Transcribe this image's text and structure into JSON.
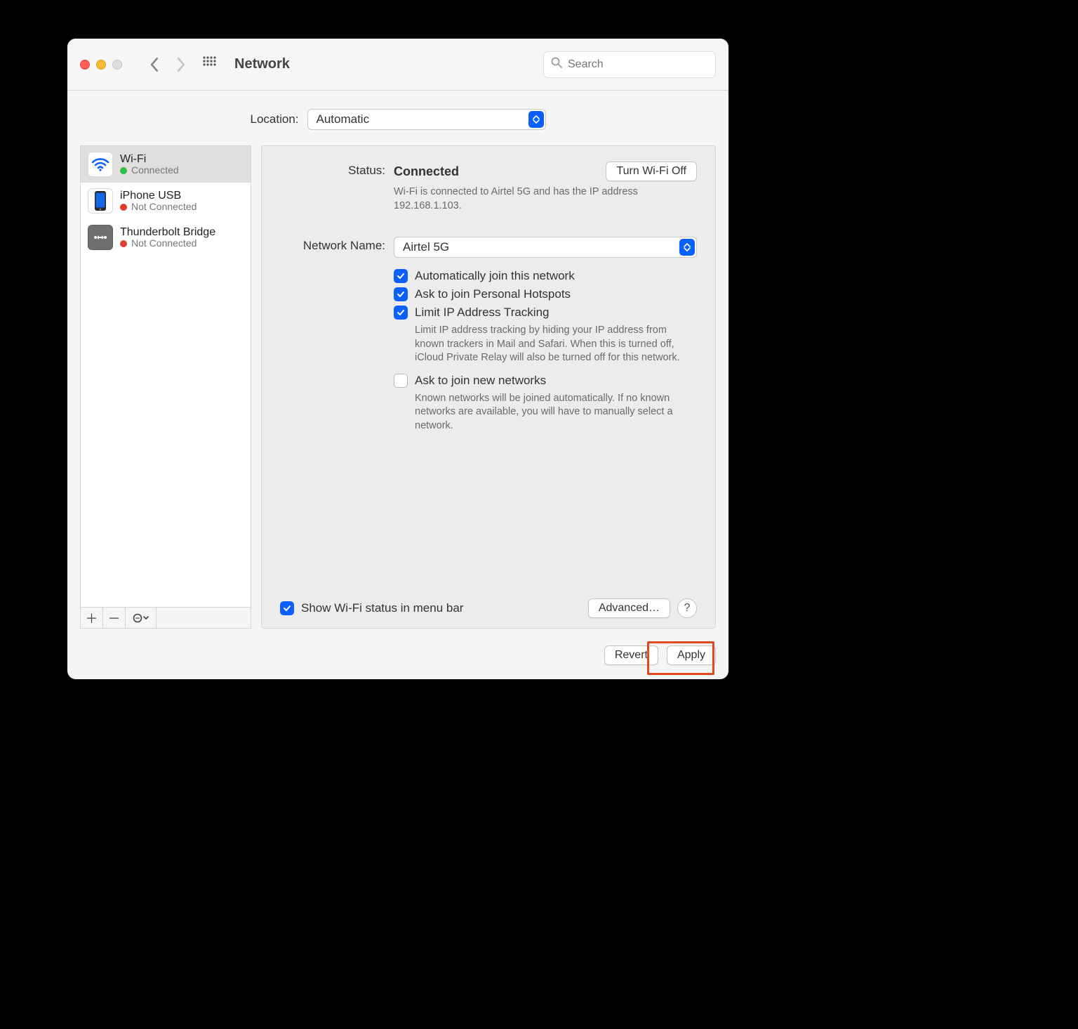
{
  "toolbar": {
    "title": "Network",
    "search_placeholder": "Search"
  },
  "location": {
    "label": "Location:",
    "value": "Automatic"
  },
  "services": [
    {
      "name": "Wi-Fi",
      "status": "Connected",
      "dot": "green",
      "icon": "wifi",
      "selected": true
    },
    {
      "name": "iPhone USB",
      "status": "Not Connected",
      "dot": "red",
      "icon": "iphone",
      "selected": false
    },
    {
      "name": "Thunderbolt Bridge",
      "status": "Not Connected",
      "dot": "red",
      "icon": "thunderbolt",
      "selected": false
    }
  ],
  "detail": {
    "status_label": "Status:",
    "status_value": "Connected",
    "wifi_toggle_label": "Turn Wi-Fi Off",
    "status_desc": "Wi-Fi is connected to Airtel 5G and has the IP address 192.168.1.103.",
    "network_name_label": "Network Name:",
    "network_name_value": "Airtel 5G",
    "checks": {
      "auto_join": "Automatically join this network",
      "personal_hotspots": "Ask to join Personal Hotspots",
      "limit_tracking": "Limit IP Address Tracking",
      "limit_tracking_hint": "Limit IP address tracking by hiding your IP address from known trackers in Mail and Safari. When this is turned off, iCloud Private Relay will also be turned off for this network.",
      "ask_join": "Ask to join new networks",
      "ask_join_hint": "Known networks will be joined automatically. If no known networks are available, you will have to manually select a network."
    },
    "show_in_menu": "Show Wi-Fi status in menu bar",
    "advanced": "Advanced…",
    "help": "?"
  },
  "footer": {
    "revert": "Revert",
    "apply": "Apply"
  }
}
